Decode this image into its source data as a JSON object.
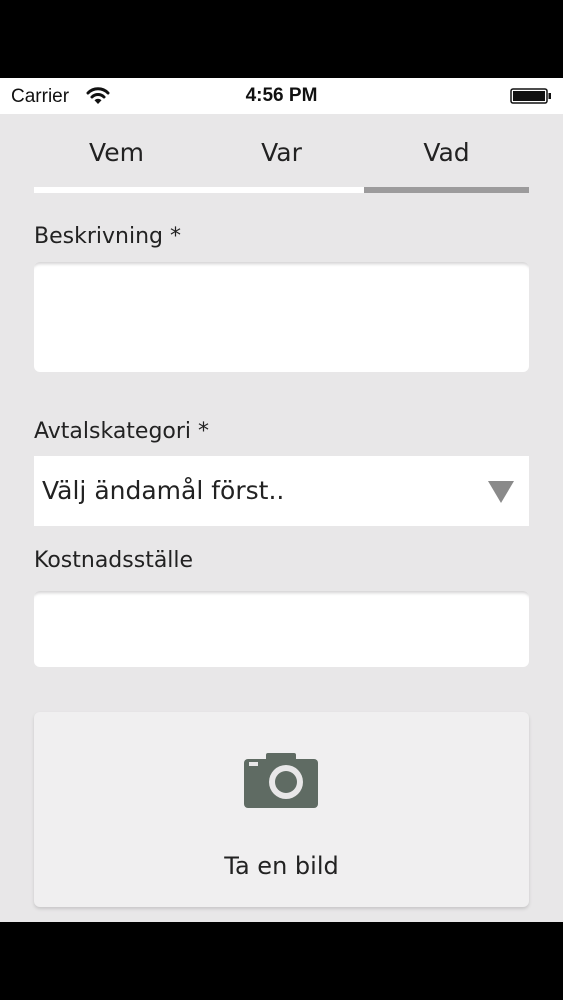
{
  "status_bar": {
    "carrier": "Carrier",
    "time": "4:56 PM"
  },
  "tabs": [
    {
      "label": "Vem",
      "selected": false
    },
    {
      "label": "Var",
      "selected": false
    },
    {
      "label": "Vad",
      "selected": true
    }
  ],
  "colors": {
    "tab_indicator_active": "#9c9b9c",
    "tab_indicator_inactive": "#ffffff",
    "background": "#e8e7e8",
    "camera_icon": "#5f6b63"
  },
  "form": {
    "description": {
      "label": "Beskrivning *",
      "value": ""
    },
    "agreement_category": {
      "label": "Avtalskategori *",
      "selected": "Välj ändamål först.."
    },
    "cost_center": {
      "label": "Kostnadsställe",
      "value": ""
    }
  },
  "camera": {
    "label": "Ta en bild",
    "icon": "camera-icon"
  }
}
